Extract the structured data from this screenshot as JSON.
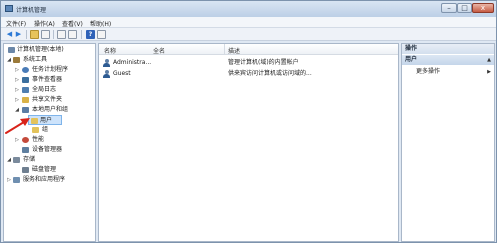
{
  "window": {
    "title": "计算机管理",
    "min_glyph": "–",
    "max_glyph": "□",
    "close_glyph": "x"
  },
  "menu": {
    "items": [
      "文件(F)",
      "操作(A)",
      "查看(V)",
      "帮助(H)"
    ]
  },
  "toolbar": {
    "back_glyph": "◀",
    "forward_glyph": "▶",
    "help_glyph": "?"
  },
  "tree": {
    "items": [
      {
        "label": "计算机管理(本地)",
        "icon": "computer-icon",
        "expander": "",
        "color": "#6b87a8"
      },
      {
        "label": "系统工具",
        "icon": "tools-icon",
        "expander": "◢",
        "color": "#9b7a3a"
      },
      {
        "label": "任务计划程序",
        "icon": "clock-icon",
        "expander": "▷",
        "color": "#4a7bb7"
      },
      {
        "label": "事件查看器",
        "icon": "event-viewer-icon",
        "expander": "▷",
        "color": "#3c6f9e"
      },
      {
        "label": "全局日志",
        "icon": "log-icon",
        "expander": "▷",
        "color": "#4f7eb0"
      },
      {
        "label": "共享文件夹",
        "icon": "shared-folder-icon",
        "expander": "▷",
        "color": "#d9b248"
      },
      {
        "label": "本地用户和组",
        "icon": "users-icon",
        "expander": "◢",
        "color": "#5a7ca5"
      },
      {
        "label": "用户",
        "icon": "folder-icon",
        "expander": "",
        "color": "#e3c35b"
      },
      {
        "label": "组",
        "icon": "folder-icon",
        "expander": "",
        "color": "#e3c35b"
      },
      {
        "label": "性能",
        "icon": "performance-icon",
        "expander": "▷",
        "color": "#c44a3b"
      },
      {
        "label": "设备管理器",
        "icon": "device-manager-icon",
        "expander": "",
        "color": "#5f7f9f"
      },
      {
        "label": "存储",
        "icon": "storage-icon",
        "expander": "◢",
        "color": "#7a8a9c"
      },
      {
        "label": "磁盘管理",
        "icon": "disk-icon",
        "expander": "",
        "color": "#6f7f90"
      },
      {
        "label": "服务和应用程序",
        "icon": "services-icon",
        "expander": "▷",
        "color": "#6f8fb0"
      }
    ]
  },
  "list": {
    "columns": [
      "名称",
      "全名",
      "描述"
    ],
    "rows": [
      {
        "name": "Administra...",
        "fullname": "",
        "description": "管理计算机(域)的内置帐户"
      },
      {
        "name": "Guest",
        "fullname": "",
        "description": "供来宾访问计算机或访问域的..."
      }
    ]
  },
  "actions": {
    "header": "操作",
    "section": "用户",
    "section_arrow": "▲",
    "more": "更多操作",
    "more_arrow": "▶"
  },
  "colors": {
    "annotation": "#d9231a",
    "selection": "#cde3fb"
  }
}
